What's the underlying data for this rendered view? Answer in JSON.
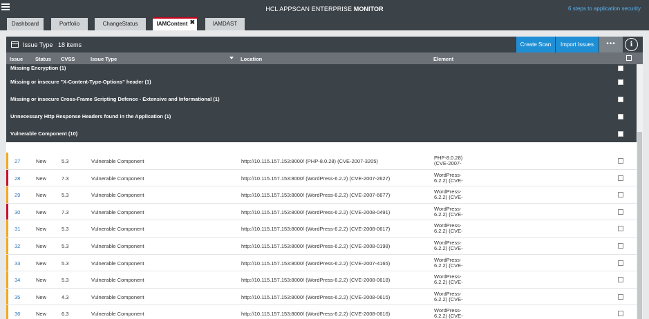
{
  "header": {
    "title_normal": "HCL APPSCAN ENTERPRISE ",
    "title_bold": "MONITOR",
    "help_link": "6 steps to application security"
  },
  "tabs": [
    {
      "label": "Dashboard"
    },
    {
      "label": "Portfolio"
    },
    {
      "label": "ChangeStatus"
    },
    {
      "label": "IAMContent",
      "close": "✖"
    },
    {
      "label": "IAMDAST"
    }
  ],
  "panel": {
    "title": "Issue Type",
    "count": "18 items",
    "create_scan": "Create Scan",
    "import_issues": "Import Issues",
    "more": "•••",
    "info": "i"
  },
  "columns": {
    "issue": "Issue",
    "status": "Status",
    "cvss": "CVSS",
    "issue_type": "Issue Type",
    "location": "Location",
    "element": "Element"
  },
  "groups": [
    {
      "label": "Missing Encryption (1)"
    },
    {
      "label": "Missing or insecure \"X-Content-Type-Options\" header (1)"
    },
    {
      "label": "Missing or insecure Cross-Frame Scripting Defence - Extensive and Informational (1)"
    },
    {
      "label": "Unnecessary Http Response Headers found in the Application (1)"
    },
    {
      "label": "Vulnerable Component (10)"
    }
  ],
  "items": [
    {
      "id": "27",
      "status": "New",
      "cvss": "5.3",
      "type": "Vulnerable Component",
      "location": "http://10.115.157.153:8000/ (PHP-8.0.28) (CVE-2007-3205)",
      "element": "PHP-8.0.28)\n(CVE-2007-",
      "severity": "medium"
    },
    {
      "id": "28",
      "status": "New",
      "cvss": "7.3",
      "type": "Vulnerable Component",
      "location": "http://10.115.157.153:8000/ (WordPress-6.2.2) (CVE-2007-2627)",
      "element": "WordPress-\n6.2.2) (CVE-",
      "severity": "high"
    },
    {
      "id": "29",
      "status": "New",
      "cvss": "5.3",
      "type": "Vulnerable Component",
      "location": "http://10.115.157.153:8000/ (WordPress-6.2.2) (CVE-2007-6677)",
      "element": "WordPress-\n6.2.2) (CVE-",
      "severity": "medium"
    },
    {
      "id": "30",
      "status": "New",
      "cvss": "7.3",
      "type": "Vulnerable Component",
      "location": "http://10.115.157.153:8000/ (WordPress-6.2.2) (CVE-2008-0491)",
      "element": "WordPress-\n6.2.2) (CVE-",
      "severity": "high"
    },
    {
      "id": "31",
      "status": "New",
      "cvss": "5.3",
      "type": "Vulnerable Component",
      "location": "http://10.115.157.153:8000/ (WordPress-6.2.2) (CVE-2008-0617)",
      "element": "WordPress-\n6.2.2) (CVE-",
      "severity": "medium"
    },
    {
      "id": "32",
      "status": "New",
      "cvss": "5.3",
      "type": "Vulnerable Component",
      "location": "http://10.115.157.153:8000/ (WordPress-6.2.2) (CVE-2008-0198)",
      "element": "WordPress-\n6.2.2) (CVE-",
      "severity": "medium"
    },
    {
      "id": "33",
      "status": "New",
      "cvss": "5.3",
      "type": "Vulnerable Component",
      "location": "http://10.115.157.153:8000/ (WordPress-6.2.2) (CVE-2007-4165)",
      "element": "WordPress-\n6.2.2) (CVE-",
      "severity": "medium"
    },
    {
      "id": "34",
      "status": "New",
      "cvss": "5.3",
      "type": "Vulnerable Component",
      "location": "http://10.115.157.153:8000/ (WordPress-6.2.2) (CVE-2008-0618)",
      "element": "WordPress-\n6.2.2) (CVE-",
      "severity": "medium"
    },
    {
      "id": "35",
      "status": "New",
      "cvss": "4.3",
      "type": "Vulnerable Component",
      "location": "http://10.115.157.153:8000/ (WordPress-6.2.2) (CVE-2008-0615)",
      "element": "WordPress-\n6.2.2) (CVE-",
      "severity": "medium"
    },
    {
      "id": "36",
      "status": "New",
      "cvss": "6.3",
      "type": "Vulnerable Component",
      "location": "http://10.115.157.153:8000/ (WordPress-6.2.2) (CVE-2008-0616)",
      "element": "WordPress-\n6.2.2) (CVE-",
      "severity": "medium"
    }
  ],
  "colors": {
    "medium": "#f4a71b",
    "high": "#c8102e",
    "accent": "#1e8fd5",
    "header_bg": "#3b4248"
  }
}
